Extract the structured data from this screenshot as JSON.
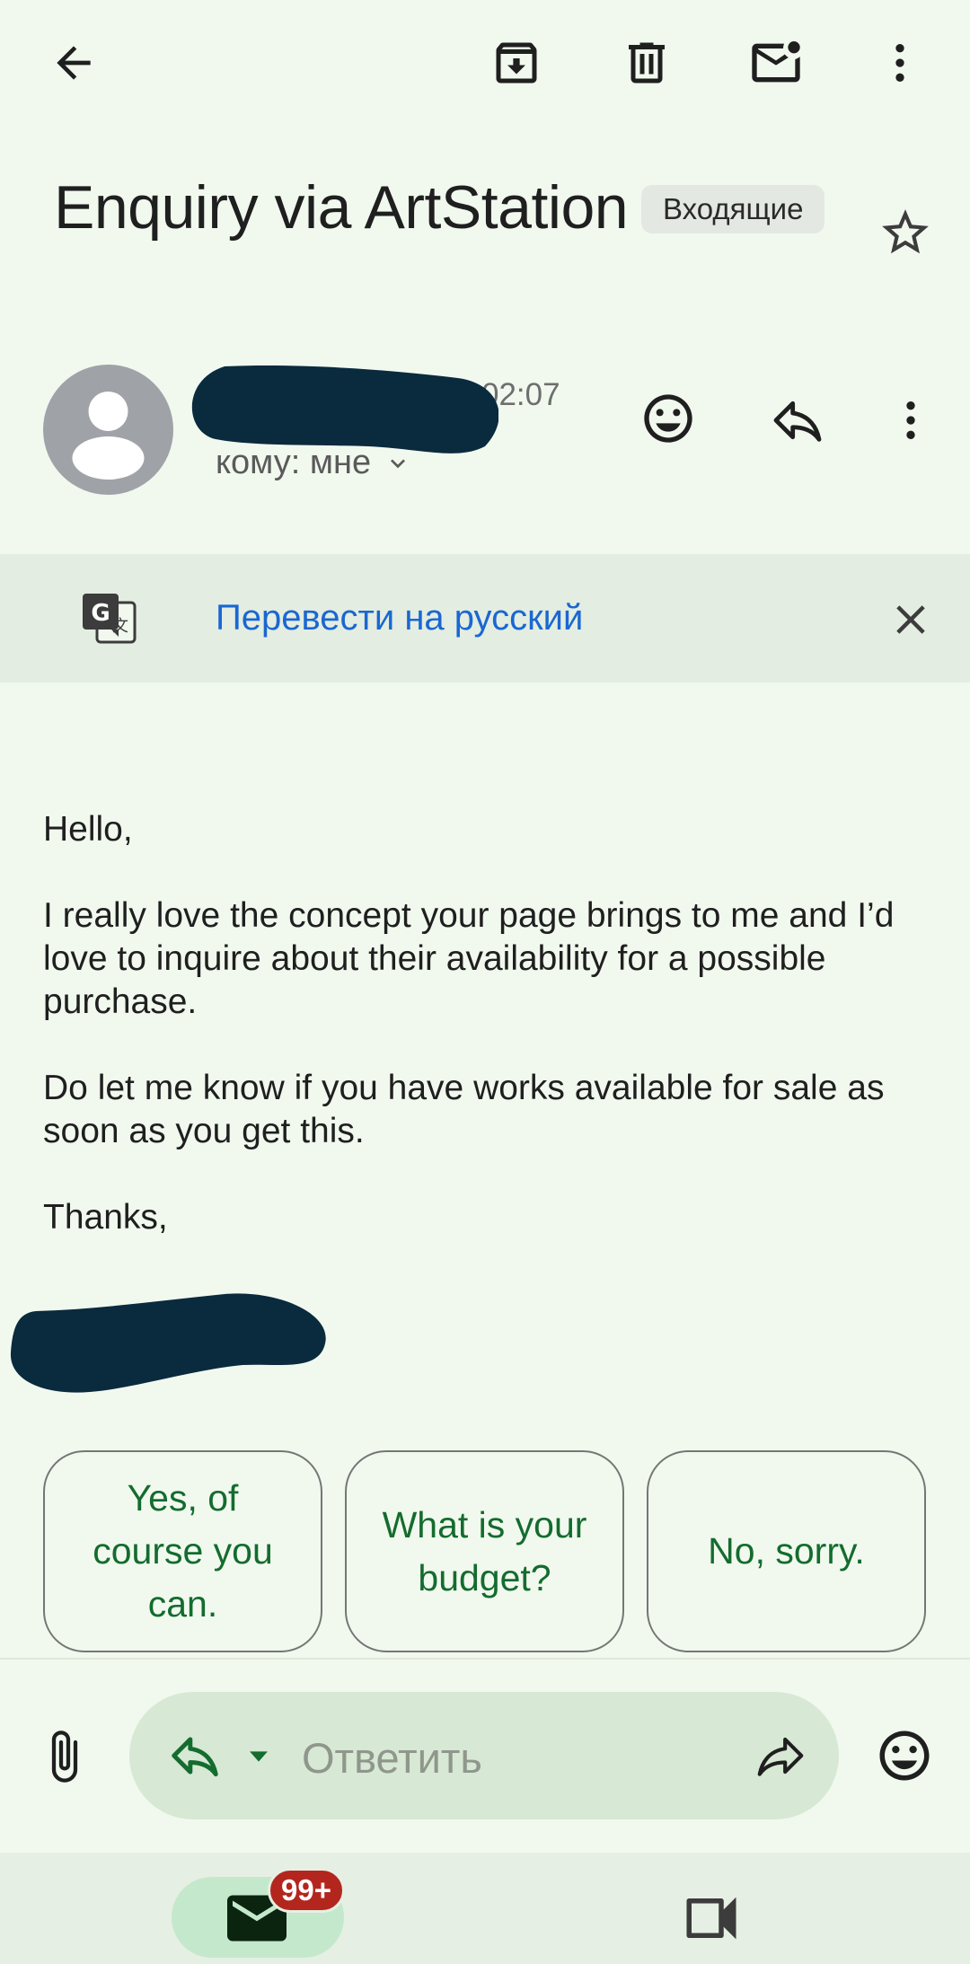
{
  "header": {
    "subject": "Enquiry via ArtStation",
    "label": "Входящие",
    "icons": [
      "back-arrow-icon",
      "archive-icon",
      "delete-icon",
      "mark-unread-icon",
      "more-vert-icon",
      "star-icon"
    ]
  },
  "sender": {
    "time": "02:07",
    "recipient": "кому: мне",
    "icons": [
      "avatar-icon",
      "emoji-icon",
      "reply-icon",
      "more-vert-icon"
    ]
  },
  "translate": {
    "link": "Перевести на русский",
    "icons": [
      "translate-icon",
      "close-icon"
    ]
  },
  "body": {
    "greeting": "Hello,",
    "paragraph1": "I really love the concept your page brings to me and I’d love to inquire about their availability for a possible purchase.",
    "paragraph2": "Do let me know if you have works available for sale as soon as you get this.",
    "signoff": "Thanks,"
  },
  "smart_replies": [
    "Yes, of course you can.",
    "What is your budget?",
    "No, sorry."
  ],
  "compose": {
    "placeholder": "Ответить",
    "icons": [
      "attach-icon",
      "reply-icon",
      "dropdown-caret-icon",
      "forward-icon",
      "emoji-icon"
    ]
  },
  "bottom_nav": {
    "mail_badge": "99+",
    "icons": [
      "mail-icon",
      "video-call-icon"
    ]
  },
  "colors": {
    "background": "#f1f9ef",
    "accent_green": "#146c2e",
    "link_blue": "#1a67d2",
    "badge_red": "#b3261e",
    "redaction": "#0a2a3e"
  }
}
